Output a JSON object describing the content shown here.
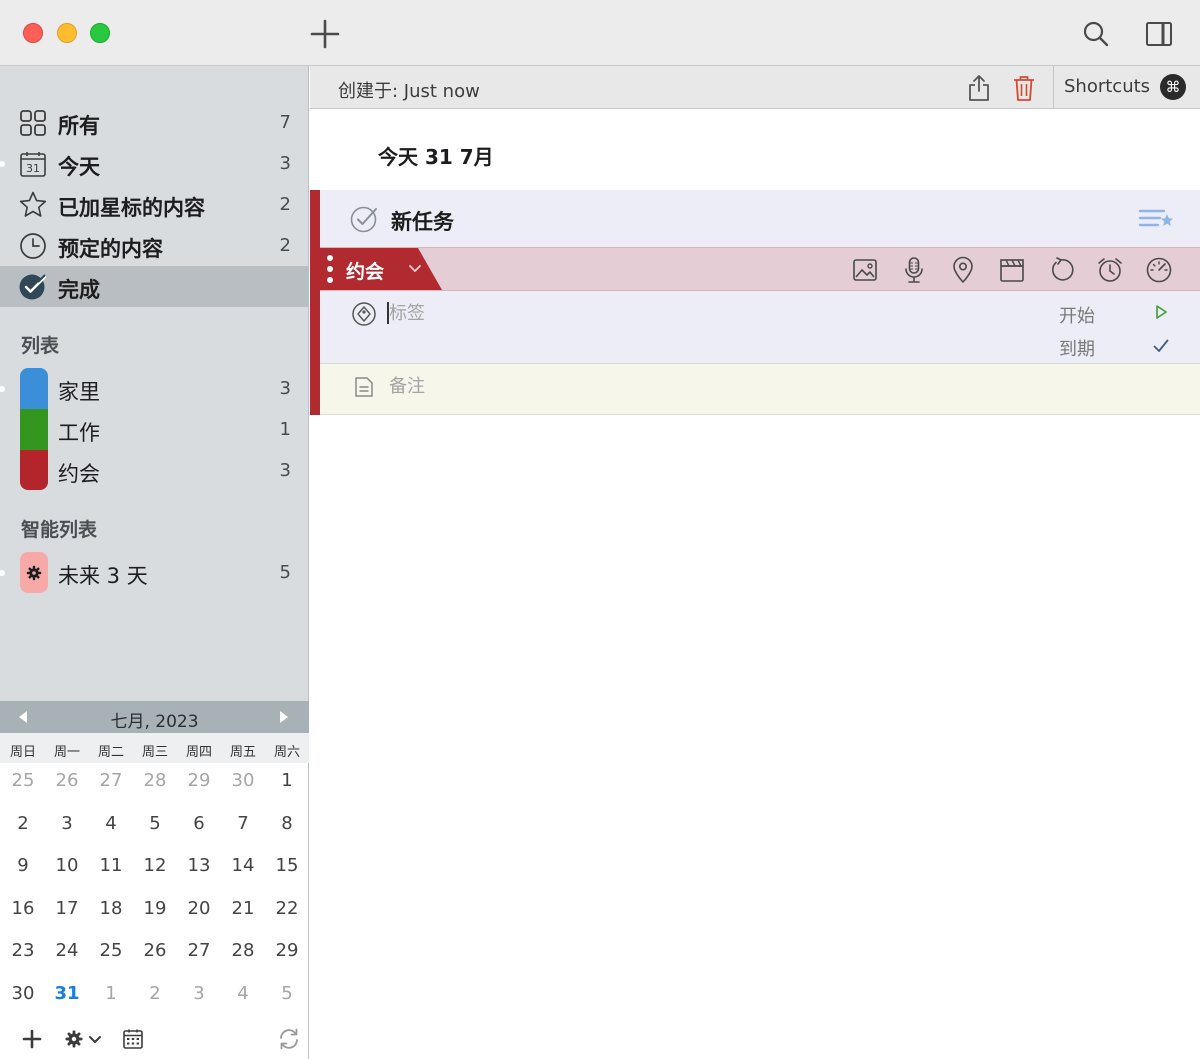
{
  "window": {
    "traffic_lights": [
      "close",
      "minimize",
      "zoom"
    ],
    "toolbar": {
      "add_icon": "plus-icon",
      "search_icon": "search-icon",
      "panel_icon": "sidebar-panel-icon"
    }
  },
  "sidebar": {
    "items": [
      {
        "label": "所有",
        "count": "7",
        "icon": "grid-icon"
      },
      {
        "label": "今天",
        "count": "3",
        "icon": "calendar-31-icon"
      },
      {
        "label": "已加星标的内容",
        "count": "2",
        "icon": "star-icon"
      },
      {
        "label": "预定的内容",
        "count": "2",
        "icon": "clock-icon"
      },
      {
        "label": "完成",
        "count": "",
        "icon": "checkmark-circle-icon",
        "selected": true
      }
    ],
    "lists_title": "列表",
    "lists": [
      {
        "label": "家里",
        "count": "3",
        "color": "#3b8fd9"
      },
      {
        "label": "工作",
        "count": "1",
        "color": "#34961f"
      },
      {
        "label": "约会",
        "count": "3",
        "color": "#b3252b"
      }
    ],
    "smart_title": "智能列表",
    "smart_lists": [
      {
        "label": "未来 3 天",
        "count": "5",
        "color": "#f7a9a8",
        "icon": "gear-icon"
      }
    ]
  },
  "calendar": {
    "title": "七月, 2023",
    "weekdays": [
      "周日",
      "周一",
      "周二",
      "周三",
      "周四",
      "周五",
      "周六"
    ],
    "weeks": [
      [
        {
          "d": "25",
          "dim": true
        },
        {
          "d": "26",
          "dim": true
        },
        {
          "d": "27",
          "dim": true
        },
        {
          "d": "28",
          "dim": true
        },
        {
          "d": "29",
          "dim": true
        },
        {
          "d": "30",
          "dim": true
        },
        {
          "d": "1"
        }
      ],
      [
        {
          "d": "2"
        },
        {
          "d": "3"
        },
        {
          "d": "4"
        },
        {
          "d": "5"
        },
        {
          "d": "6"
        },
        {
          "d": "7"
        },
        {
          "d": "8"
        }
      ],
      [
        {
          "d": "9"
        },
        {
          "d": "10"
        },
        {
          "d": "11"
        },
        {
          "d": "12"
        },
        {
          "d": "13"
        },
        {
          "d": "14"
        },
        {
          "d": "15"
        }
      ],
      [
        {
          "d": "16"
        },
        {
          "d": "17"
        },
        {
          "d": "18"
        },
        {
          "d": "19"
        },
        {
          "d": "20"
        },
        {
          "d": "21"
        },
        {
          "d": "22"
        }
      ],
      [
        {
          "d": "23"
        },
        {
          "d": "24"
        },
        {
          "d": "25"
        },
        {
          "d": "26"
        },
        {
          "d": "27"
        },
        {
          "d": "28"
        },
        {
          "d": "29"
        }
      ],
      [
        {
          "d": "30"
        },
        {
          "d": "31",
          "today": true
        },
        {
          "d": "1",
          "dim": true
        },
        {
          "d": "2",
          "dim": true
        },
        {
          "d": "3",
          "dim": true
        },
        {
          "d": "4",
          "dim": true
        },
        {
          "d": "5",
          "dim": true
        }
      ]
    ],
    "footer_icons": [
      "plus-icon",
      "gear-dropdown-icon",
      "calendar-icon",
      "sync-icon"
    ]
  },
  "main": {
    "created_label": "创建于: Just now",
    "shortcuts_label": "Shortcuts",
    "shortcuts_key": "⌘",
    "date_heading": "今天 31 7月",
    "task": {
      "title": "新任务",
      "list_name": "约会",
      "list_color": "#b02a2f",
      "tools": [
        "image-icon",
        "microphone-icon",
        "location-pin-icon",
        "clapperboard-icon",
        "repeat-icon",
        "alarm-icon",
        "timer-icon"
      ],
      "tags_placeholder": "标签",
      "start_label": "开始",
      "due_label": "到期",
      "notes_placeholder": "备注"
    }
  }
}
